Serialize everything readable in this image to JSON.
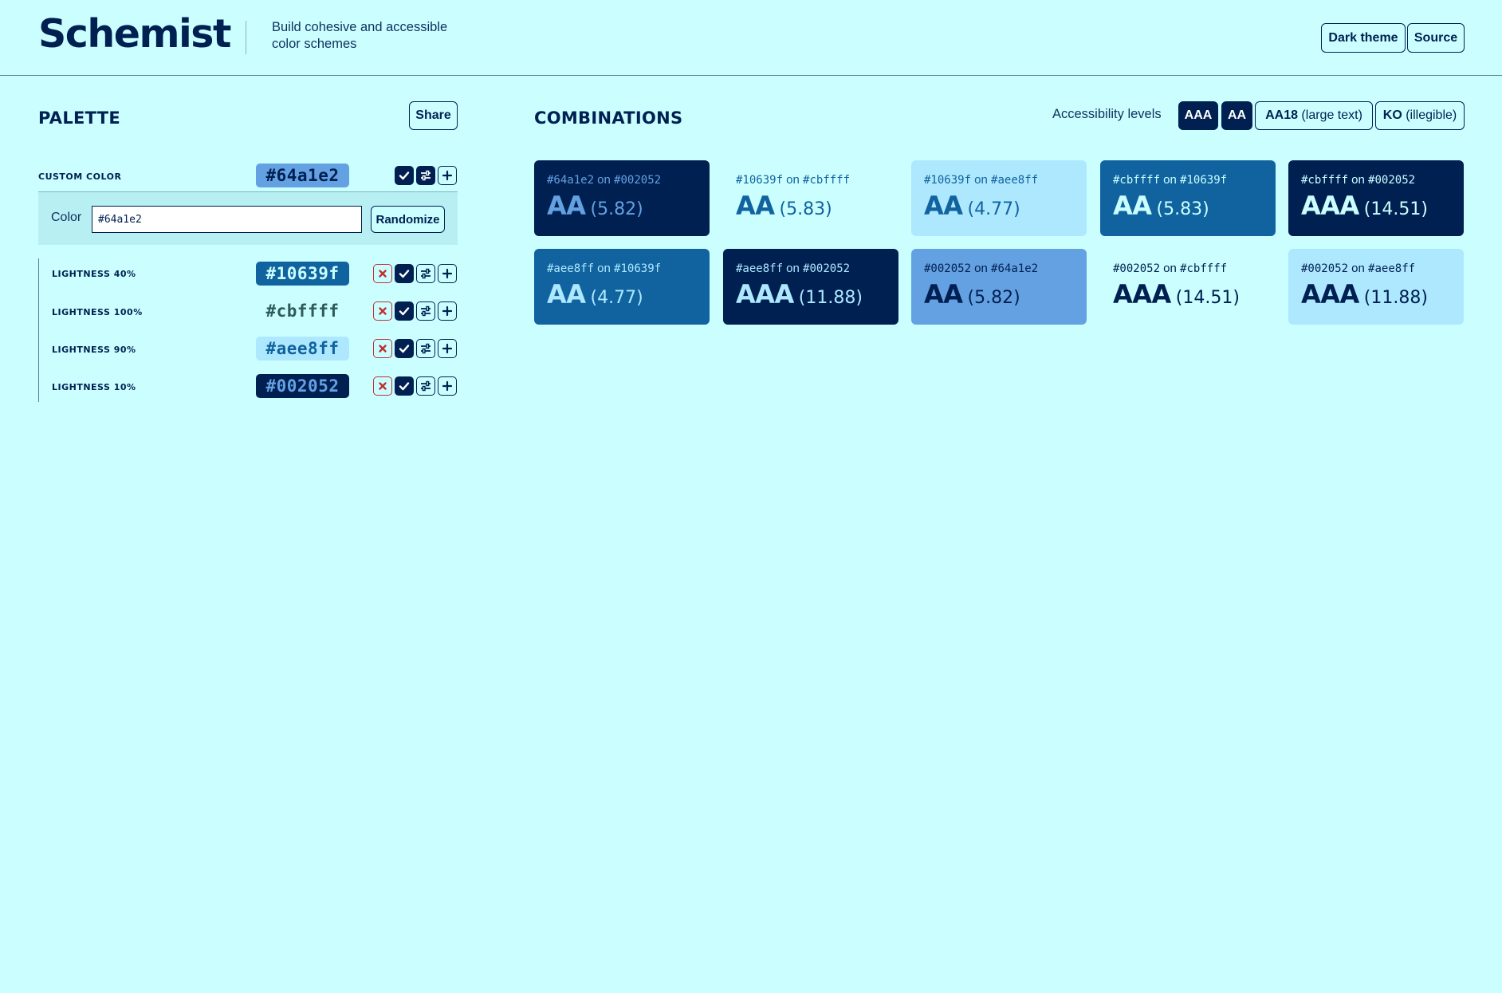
{
  "header": {
    "logo": "Schemist",
    "tagline": "Build cohesive and accessible color schemes",
    "dark_theme_label": "Dark theme",
    "source_label": "Source"
  },
  "palette": {
    "title": "PALETTE",
    "share_label": "Share",
    "custom": {
      "label": "CUSTOM COLOR",
      "hex": "#64a1e2",
      "editor_label": "Color",
      "input_value": "#64a1e2",
      "randomize_label": "Randomize"
    },
    "rows": [
      {
        "label": "LIGHTNESS 40%",
        "hex": "#10639f"
      },
      {
        "label": "LIGHTNESS 100%",
        "hex": "#cbffff"
      },
      {
        "label": "LIGHTNESS 90%",
        "hex": "#aee8ff"
      },
      {
        "label": "LIGHTNESS 10%",
        "hex": "#002052"
      }
    ],
    "icons": {
      "remove": "close-icon",
      "select": "check-icon",
      "adjust": "sliders-icon",
      "add": "plus-icon"
    }
  },
  "combinations": {
    "title": "COMBINATIONS",
    "levels_label": "Accessibility levels",
    "levels": [
      {
        "label": "AAA",
        "suffix": ""
      },
      {
        "label": "AA",
        "suffix": ""
      },
      {
        "label": "AA18",
        "suffix": " (large text)"
      },
      {
        "label": "KO",
        "suffix": " (illegible)"
      }
    ],
    "connector": "on",
    "cards": [
      {
        "fg": "#64a1e2",
        "bg": "#002052",
        "level": "AA",
        "ratio": "(5.82)"
      },
      {
        "fg": "#10639f",
        "bg": "#cbffff",
        "level": "AA",
        "ratio": "(5.83)"
      },
      {
        "fg": "#10639f",
        "bg": "#aee8ff",
        "level": "AA",
        "ratio": "(4.77)"
      },
      {
        "fg": "#cbffff",
        "bg": "#10639f",
        "level": "AA",
        "ratio": "(5.83)"
      },
      {
        "fg": "#cbffff",
        "bg": "#002052",
        "level": "AAA",
        "ratio": "(14.51)"
      },
      {
        "fg": "#aee8ff",
        "bg": "#10639f",
        "level": "AA",
        "ratio": "(4.77)"
      },
      {
        "fg": "#aee8ff",
        "bg": "#002052",
        "level": "AAA",
        "ratio": "(11.88)"
      },
      {
        "fg": "#002052",
        "bg": "#64a1e2",
        "level": "AA",
        "ratio": "(5.82)"
      },
      {
        "fg": "#002052",
        "bg": "#cbffff",
        "level": "AAA",
        "ratio": "(14.51)"
      },
      {
        "fg": "#002052",
        "bg": "#aee8ff",
        "level": "AAA",
        "ratio": "(11.88)"
      }
    ]
  },
  "colors": {
    "page_bg": "#cbffff",
    "text": "#002052",
    "accent": "#64a1e2",
    "remove_red": "#c03030"
  }
}
